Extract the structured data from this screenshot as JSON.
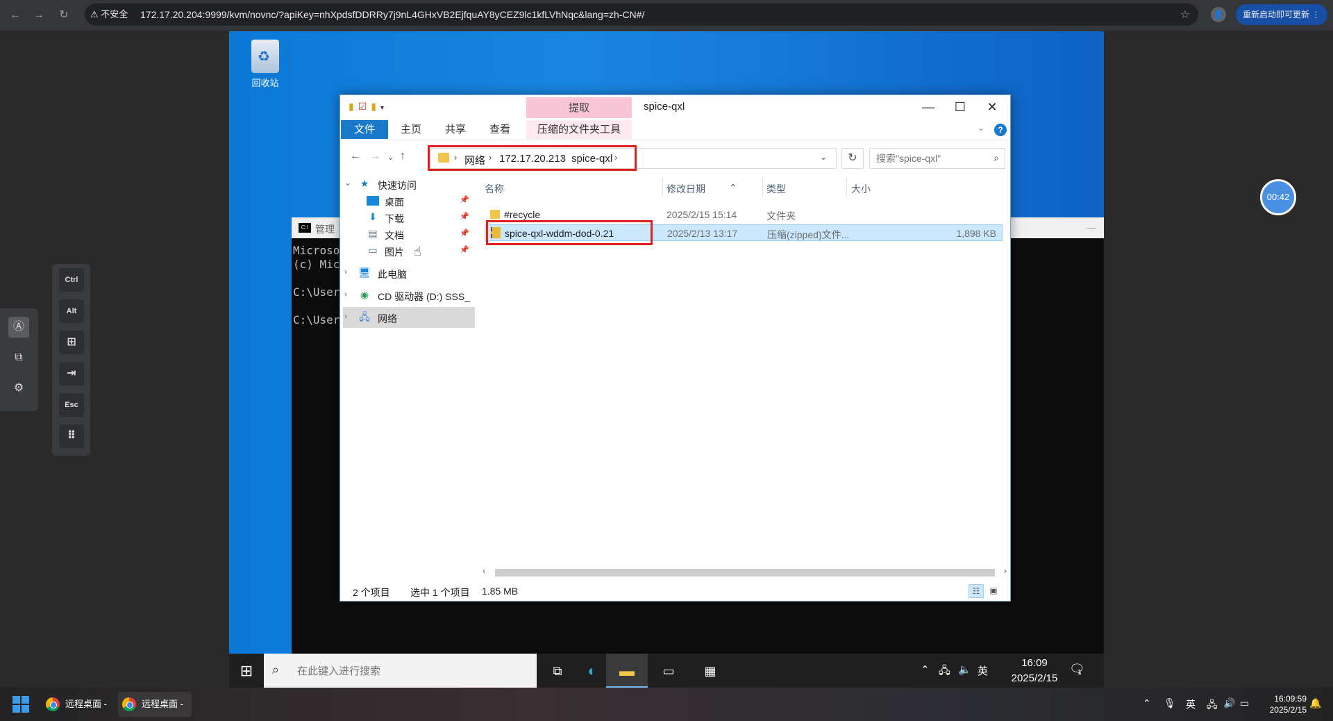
{
  "browser": {
    "insecure_label": "不安全",
    "url": "172.17.20.204:9999/kvm/novnc/?apiKey=nhXpdsfDDRRy7j9nL4GHxVB2EjfquAY8yCEZ9lc1kfLVhNqc&lang=zh-CN#/",
    "update_label": "重新启动即可更新"
  },
  "desktop": {
    "recycle_bin_label": "回收站"
  },
  "cmd_window": {
    "title": "管理",
    "lines": [
      "Microso",
      "(c) Mic",
      "",
      "C:\\User",
      "",
      "C:\\User"
    ]
  },
  "explorer": {
    "extract_tab": "提取",
    "title": "spice-qxl",
    "ribbon_tabs": {
      "file": "文件",
      "home": "主页",
      "share": "共享",
      "view": "查看",
      "compress_tools": "压缩的文件夹工具"
    },
    "breadcrumb": [
      "网络",
      "172.17.20.213",
      "spice-qxl"
    ],
    "search_placeholder": "搜索\"spice-qxl\"",
    "nav": {
      "quick_access": "快速访问",
      "desktop": "桌面",
      "downloads": "下载",
      "documents": "文档",
      "pictures": "图片",
      "this_pc": "此电脑",
      "cd_drive": "CD 驱动器 (D:) SSS_",
      "network": "网络"
    },
    "columns": {
      "name": "名称",
      "modified": "修改日期",
      "type": "类型",
      "size": "大小"
    },
    "files": [
      {
        "name": "#recycle",
        "modified": "2025/2/15 15:14",
        "type": "文件夹",
        "size": ""
      },
      {
        "name": "spice-qxl-wddm-dod-0.21",
        "modified": "2025/2/13 13:17",
        "type": "压缩(zipped)文件...",
        "size": "1,898 KB"
      }
    ],
    "status": {
      "item_count": "2 个项目",
      "selected": "选中 1 个项目",
      "selected_size": "1.85 MB"
    }
  },
  "vm_taskbar": {
    "search_placeholder": "在此键入进行搜索",
    "ime": "英",
    "time": "16:09",
    "date": "2025/2/15",
    "notification_count": "1"
  },
  "remote_toolbar": {
    "timer": "00:42",
    "keys": [
      "Ctrl",
      "Alt",
      "Esc"
    ]
  },
  "host_taskbar": {
    "apps": [
      {
        "label": "远程桌面 -"
      },
      {
        "label": "远程桌面 -"
      }
    ],
    "ime": "英",
    "time": "16:09:59",
    "date": "2025/2/15"
  }
}
